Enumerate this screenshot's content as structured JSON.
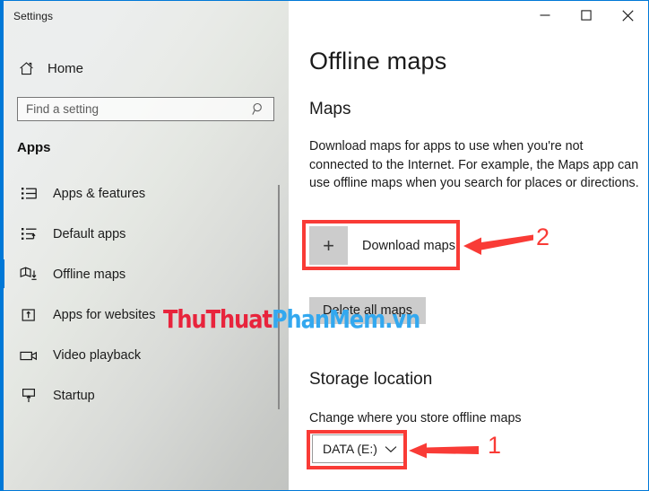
{
  "window": {
    "title": "Settings",
    "accent_color": "#0078d7",
    "controls": [
      {
        "name": "minimize",
        "glyph": "─"
      },
      {
        "name": "maximize",
        "glyph": "□"
      },
      {
        "name": "close",
        "glyph": "✕"
      }
    ]
  },
  "sidebar": {
    "home_label": "Home",
    "home_icon": "home-icon",
    "search": {
      "placeholder": "Find a setting",
      "value": "",
      "icon": "search-icon"
    },
    "group_title": "Apps",
    "items": [
      {
        "label": "Apps & features",
        "icon": "list-bullets-icon",
        "selected": false
      },
      {
        "label": "Default apps",
        "icon": "list-arrow-icon",
        "selected": false
      },
      {
        "label": "Offline maps",
        "icon": "map-download-icon",
        "selected": true
      },
      {
        "label": "Apps for websites",
        "icon": "box-arrow-up-icon",
        "selected": false
      },
      {
        "label": "Video playback",
        "icon": "video-camera-icon",
        "selected": false
      },
      {
        "label": "Startup",
        "icon": "monitor-arrow-up-icon",
        "selected": false
      }
    ]
  },
  "main": {
    "page_title": "Offline maps",
    "maps_section": {
      "title": "Maps",
      "description": "Download maps for apps to use when you're not connected to the Internet. For example, the Maps app can use offline maps when you search for places or directions.",
      "download_button_label": "Download maps",
      "download_button_icon": "plus-icon",
      "delete_button_label": "Delete all maps"
    },
    "storage_section": {
      "title": "Storage location",
      "description": "Change where you store offline maps",
      "dropdown_value": "DATA (E:)",
      "dropdown_icon": "chevron-down-icon"
    }
  },
  "annotations": {
    "color": "#f93b36",
    "markers": [
      {
        "number": "2",
        "target": "download-maps-button"
      },
      {
        "number": "1",
        "target": "storage-dropdown"
      }
    ]
  },
  "watermark": {
    "text_red": "ThuThuat",
    "text_blue": "PhanMem.vn",
    "color_red": "#e8243c",
    "color_blue": "#33a8ef"
  }
}
